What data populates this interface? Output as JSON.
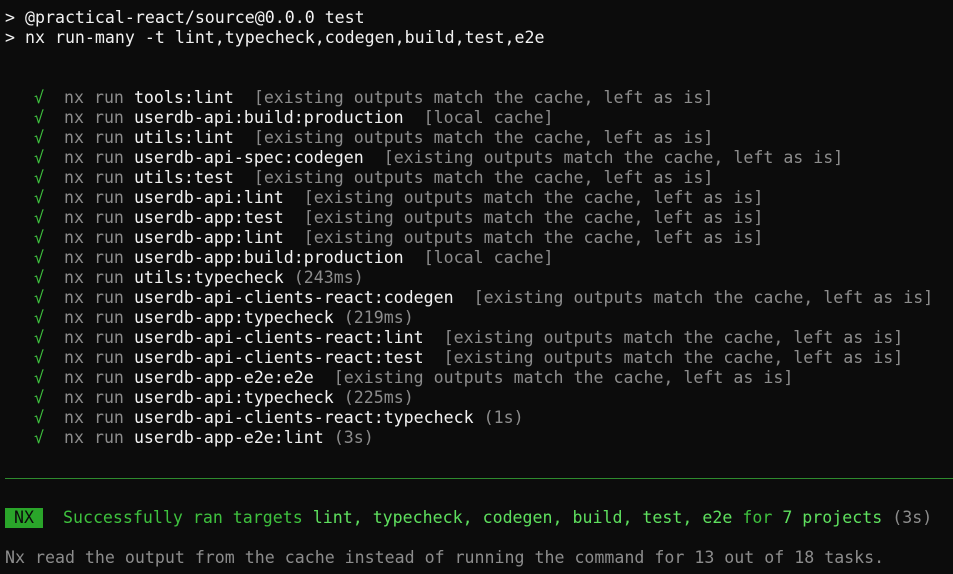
{
  "header": {
    "line1": "> @practical-react/source@0.0.0 test",
    "line2": "> nx run-many -t lint,typecheck,codegen,build,test,e2e"
  },
  "check_symbol": "√",
  "run_prefix": "nx run",
  "tasks": [
    {
      "target": "tools:lint",
      "status": "[existing outputs match the cache, left as is]"
    },
    {
      "target": "userdb-api:build:production",
      "status": "[local cache]"
    },
    {
      "target": "utils:lint",
      "status": "[existing outputs match the cache, left as is]"
    },
    {
      "target": "userdb-api-spec:codegen",
      "status": "[existing outputs match the cache, left as is]"
    },
    {
      "target": "utils:test",
      "status": "[existing outputs match the cache, left as is]"
    },
    {
      "target": "userdb-api:lint",
      "status": "[existing outputs match the cache, left as is]"
    },
    {
      "target": "userdb-app:test",
      "status": "[existing outputs match the cache, left as is]"
    },
    {
      "target": "userdb-app:lint",
      "status": "[existing outputs match the cache, left as is]"
    },
    {
      "target": "userdb-app:build:production",
      "status": "[local cache]"
    },
    {
      "target": "utils:typecheck",
      "status": "(243ms)"
    },
    {
      "target": "userdb-api-clients-react:codegen",
      "status": "[existing outputs match the cache, left as is]"
    },
    {
      "target": "userdb-app:typecheck",
      "status": "(219ms)"
    },
    {
      "target": "userdb-api-clients-react:lint",
      "status": "[existing outputs match the cache, left as is]"
    },
    {
      "target": "userdb-api-clients-react:test",
      "status": "[existing outputs match the cache, left as is]"
    },
    {
      "target": "userdb-app-e2e:e2e",
      "status": "[existing outputs match the cache, left as is]"
    },
    {
      "target": "userdb-api:typecheck",
      "status": "(225ms)"
    },
    {
      "target": "userdb-api-clients-react:typecheck",
      "status": "(1s)"
    },
    {
      "target": "userdb-app-e2e:lint",
      "status": "(3s)"
    }
  ],
  "summary": {
    "badge": "NX",
    "prefix": "Successfully ran targets",
    "targets": "lint, typecheck, codegen, build, test, e2e",
    "middle": "for",
    "projects": "7 projects",
    "duration": "(3s)"
  },
  "cache_note": "Nx read the output from the cache instead of running the command for 13 out of 18 tasks.",
  "colors": {
    "background": "#0c0c0c",
    "success_green": "#3ec13e",
    "dim_text": "#8c8c8c"
  }
}
